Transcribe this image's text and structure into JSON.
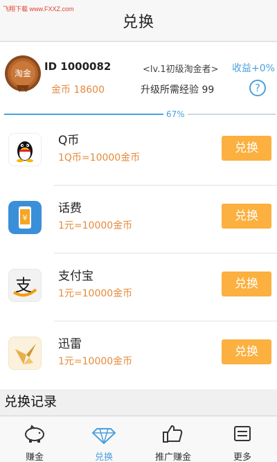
{
  "watermark": "飞翔下载 www.FXXZ.com",
  "header": {
    "title": "兑换"
  },
  "profile": {
    "medal_text": "淘金",
    "user_id": "ID 1000082",
    "coins": "金币 18600",
    "level": "<lv.1初级淘金者>",
    "income": "收益+0%",
    "exp": "升级所需经验 99",
    "help_symbol": "?",
    "progress_label": "67%",
    "progress_fraction": 0.67
  },
  "items": [
    {
      "name": "Q币",
      "rate": "1Q币=10000金币",
      "button": "兑换",
      "icon": "qq-penguin-icon"
    },
    {
      "name": "话费",
      "rate": "1元=10000金币",
      "button": "兑换",
      "icon": "phone-yuan-icon"
    },
    {
      "name": "支付宝",
      "rate": "1元=10000金币",
      "button": "兑换",
      "icon": "alipay-icon"
    },
    {
      "name": "迅雷",
      "rate": "1元=10000金币",
      "button": "兑换",
      "icon": "xunlei-bird-icon"
    }
  ],
  "records": {
    "title": "兑换记录"
  },
  "tabs": [
    {
      "label": "赚金",
      "icon": "piggy-bank-icon"
    },
    {
      "label": "兑换",
      "icon": "diamond-icon"
    },
    {
      "label": "推广赚金",
      "icon": "thumbs-up-icon"
    },
    {
      "label": "更多",
      "icon": "more-icon"
    }
  ],
  "colors": {
    "accent": "#4aa0dc",
    "button": "#fbb040",
    "coin_text": "#e58a3c"
  }
}
